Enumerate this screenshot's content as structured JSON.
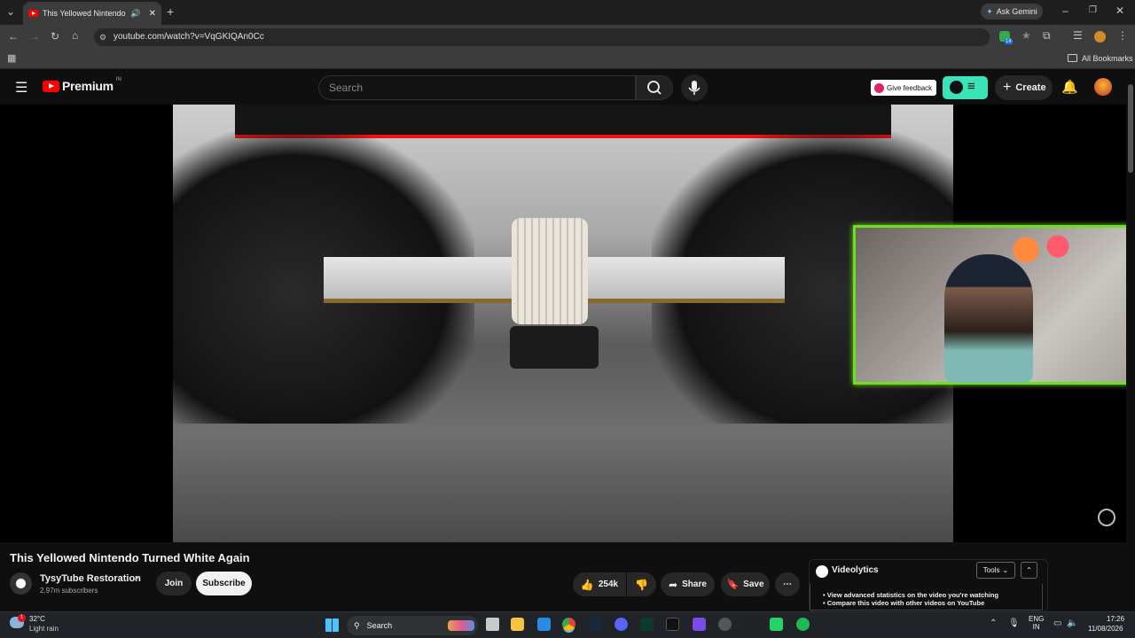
{
  "browser": {
    "tab_title": "This Yellowed Nintendo Tu",
    "ask_gemini": "Ask Gemini",
    "url": "youtube.com/watch?v=VqGKIQAn0Cc",
    "all_bookmarks": "All Bookmarks",
    "extension_badge": "14"
  },
  "youtube": {
    "logo_text": "Premium",
    "logo_region": "IN",
    "search_placeholder": "Search",
    "give_feedback": "Give feedback",
    "create_label": "Create"
  },
  "video": {
    "title": "This Yellowed Nintendo Turned White Again",
    "channel_name": "TysyTube Restoration",
    "subscribers": "2.97m subscribers",
    "join_label": "Join",
    "subscribe_label": "Subscribe",
    "likes": "254k",
    "share_label": "Share",
    "save_label": "Save"
  },
  "videolytics": {
    "title": "Videolytics",
    "tools_label": "Tools",
    "bullets": [
      "View advanced statistics on the video you're watching",
      "Compare this video with other videos on YouTube"
    ]
  },
  "taskbar": {
    "weather_temp": "32°C",
    "weather_desc": "Light rain",
    "search_label": "Search",
    "lang_top": "ENG",
    "lang_bottom": "IN",
    "time": "17:26",
    "date": "11/08/2026",
    "notification_badge": "1"
  },
  "colors": {
    "yt_red": "#ff0000",
    "videolytics_accent": "#3be3b8",
    "webcam_border": "#6ee01e"
  }
}
